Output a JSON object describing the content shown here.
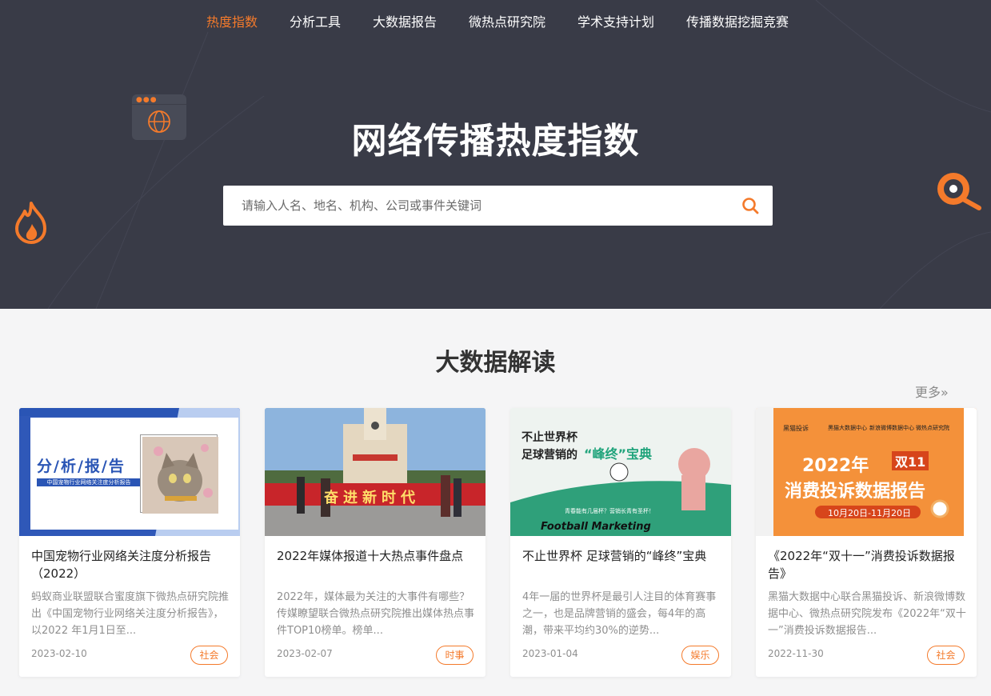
{
  "nav": {
    "items": [
      {
        "label": "热度指数",
        "active": true
      },
      {
        "label": "分析工具",
        "active": false
      },
      {
        "label": "大数据报告",
        "active": false
      },
      {
        "label": "微热点研究院",
        "active": false
      },
      {
        "label": "学术支持计划",
        "active": false
      },
      {
        "label": "传播数据挖掘竞赛",
        "active": false
      }
    ]
  },
  "hero": {
    "title": "网络传播热度指数",
    "search_placeholder": "请输入人名、地名、机构、公司或事件关键词",
    "search_value": ""
  },
  "section": {
    "title": "大数据解读",
    "more_label": "更多»"
  },
  "cards": [
    {
      "title": "中国宠物行业网络关注度分析报告（2022）",
      "desc": "蚂蚁商业联盟联合蜜度旗下微热点研究院推出《中国宠物行业网络关注度分析报告》，以2022 年1月1日至...",
      "date": "2023-02-10",
      "tag": "社会",
      "image_text": {
        "headline": "分/析/报/告",
        "sub": "中国宠物行业网络关注度分析报告"
      }
    },
    {
      "title": "2022年媒体报道十大热点事件盘点",
      "desc": "2022年，媒体最为关注的大事件有哪些？传媒瞭望联合微热点研究院推出媒体热点事件TOP10榜单。榜单...",
      "date": "2023-02-07",
      "tag": "时事",
      "image_text": {
        "banner": "奋进新时代"
      }
    },
    {
      "title": "不止世界杯 足球营销的“峰终”宝典",
      "desc": "4年一届的世界杯是最引人注目的体育赛事之一，也是品牌营销的盛会，每4年的高潮，带来平均约30%的逆势...",
      "date": "2023-01-04",
      "tag": "娱乐",
      "image_text": {
        "line1": "不止世界杯",
        "line2": "足球营销的",
        "highlight": "“峰终”宝典",
        "banner": "青春能有几届杯？营销长青有圣杯！",
        "footer": "Football Marketing"
      }
    },
    {
      "title": "《2022年“双十一”消费投诉数据报告》",
      "desc": "黑猫大数据中心联合黑猫投诉、新浪微博数据中心、微热点研究院发布《2022年“双十一”消费投诉数据报告...",
      "date": "2022-11-30",
      "tag": "社会",
      "image_text": {
        "logos": [
          "黑猫投诉",
          "黑猫大数据中心",
          "新浪微博数据中心",
          "微热点研究院"
        ],
        "year": "2022年",
        "badge": "双11",
        "headline": "消费投诉数据报告",
        "dates": "10月20日-11月20日"
      }
    }
  ],
  "colors": {
    "accent": "#f47a2b",
    "hero_bg": "#393b47",
    "page_bg": "#f5f5f6"
  }
}
